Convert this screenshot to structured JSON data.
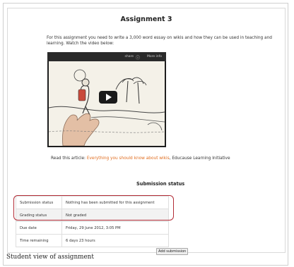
{
  "assignment": {
    "title": "Assignment 3",
    "intro": "For this assignment you need to write a 3,000 word essay on wikis and how they can be used in teaching and learning. Watch the video below:",
    "video": {
      "share_label": "share",
      "more_label": "More info",
      "icons": [
        "info-icon",
        "play-icon"
      ]
    },
    "article": {
      "prefix": "Read this article: ",
      "link_text": "Everything you should know about wikis",
      "suffix": ", Educause Learning Initiative"
    }
  },
  "submission": {
    "heading": "Submission status",
    "rows": [
      {
        "label": "Submission status",
        "value": "Nothing has been submitted for this assignment"
      },
      {
        "label": "Grading status",
        "value": "Not graded"
      },
      {
        "label": "Due date",
        "value": "Friday, 29 June 2012, 3:05 PM"
      },
      {
        "label": "Time remaining",
        "value": "6 days 23 hours"
      }
    ],
    "add_button": "Add submission"
  },
  "caption": "Student view of assignment",
  "colors": {
    "link": "#e06c1e",
    "highlight": "#b32d37"
  }
}
